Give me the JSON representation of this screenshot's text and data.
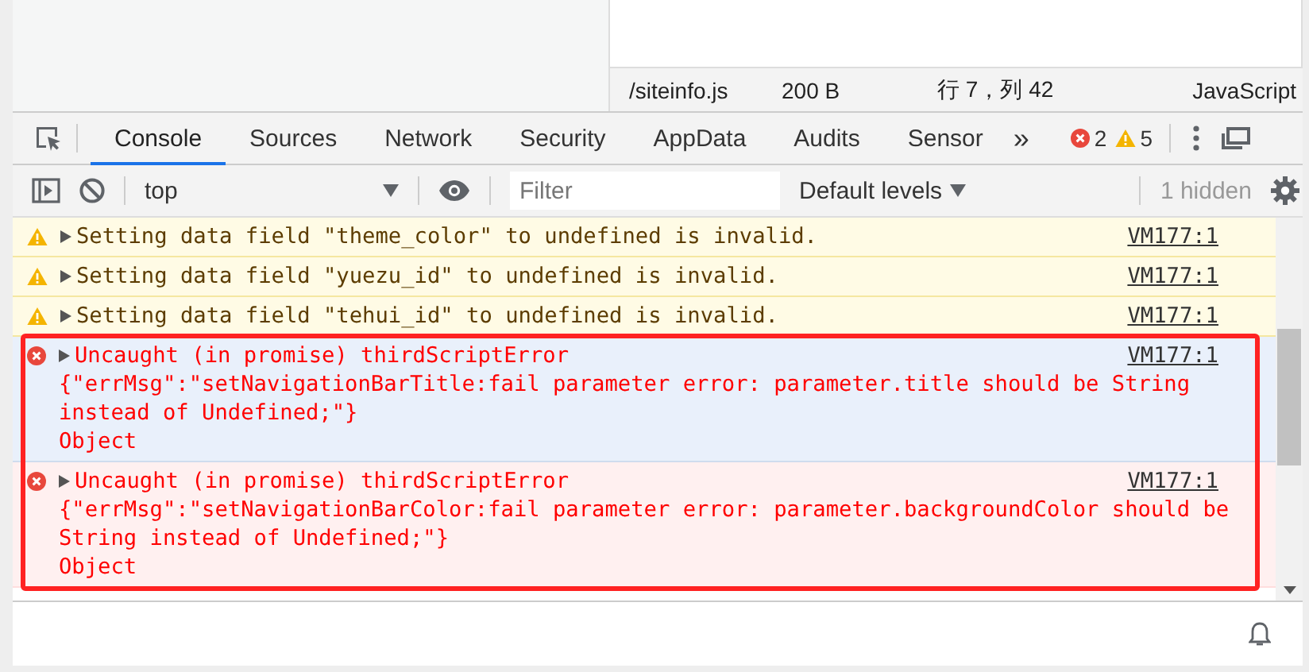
{
  "status_bar": {
    "file": "/siteinfo.js",
    "size": "200 B",
    "position": "行 7，列 42",
    "language": "JavaScript"
  },
  "tabs": [
    {
      "label": "Console",
      "selected": true
    },
    {
      "label": "Sources",
      "selected": false
    },
    {
      "label": "Network",
      "selected": false
    },
    {
      "label": "Security",
      "selected": false
    },
    {
      "label": "AppData",
      "selected": false
    },
    {
      "label": "Audits",
      "selected": false
    },
    {
      "label": "Sensor",
      "selected": false
    }
  ],
  "more_tabs": "»",
  "error_count": "2",
  "warning_count": "5",
  "toolbar": {
    "context": "top",
    "filter": {
      "placeholder": "Filter"
    },
    "levels": "Default levels",
    "hidden": "1 hidden"
  },
  "messages": [
    {
      "kind": "warning",
      "selected": false,
      "lines": [
        "Setting data field \"theme_color\" to undefined is invalid."
      ],
      "source": "VM177:1"
    },
    {
      "kind": "warning",
      "selected": false,
      "lines": [
        "Setting data field \"yuezu_id\" to undefined is invalid."
      ],
      "source": "VM177:1"
    },
    {
      "kind": "warning",
      "selected": false,
      "lines": [
        "Setting data field \"tehui_id\" to undefined is invalid."
      ],
      "source": "VM177:1"
    },
    {
      "kind": "error",
      "selected": true,
      "lines": [
        "Uncaught (in promise) thirdScriptError",
        "{\"errMsg\":\"setNavigationBarTitle:fail parameter error: parameter.title should be String instead of Undefined;\"}",
        "Object"
      ],
      "source": "VM177:1"
    },
    {
      "kind": "error",
      "selected": false,
      "lines": [
        "Uncaught (in promise) thirdScriptError",
        "{\"errMsg\":\"setNavigationBarColor:fail parameter error: parameter.backgroundColor should be String instead of Undefined;\"}",
        "Object"
      ],
      "source": "VM177:1"
    }
  ]
}
